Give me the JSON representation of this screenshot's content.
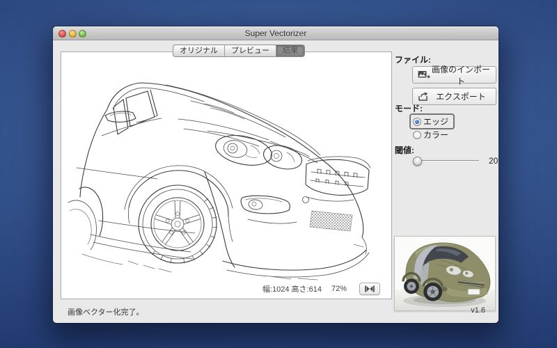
{
  "window": {
    "title": "Super Vectorizer"
  },
  "tabs": [
    {
      "label": "オリジナル",
      "selected": false
    },
    {
      "label": "プレビュー",
      "selected": false
    },
    {
      "label": "結果",
      "selected": true
    }
  ],
  "sidebar": {
    "file_section_label": "ファイル:",
    "import_button": "画像のインポート",
    "export_button": "エクスポート",
    "mode_section_label": "モード:",
    "mode_options": [
      {
        "label": "エッジ",
        "selected": true
      },
      {
        "label": "カラー",
        "selected": false
      }
    ],
    "threshold_label": "閾値:",
    "threshold_value": "20"
  },
  "canvas": {
    "size_label": "幅:1024 高さ:614",
    "zoom_label": "72%"
  },
  "footer": {
    "status_message": "画像ベクター化完了。",
    "version": "v1.6"
  },
  "icons": {
    "import": "photo-import-icon",
    "export": "export-arrow-icon",
    "fit": "fit-to-window-icon"
  },
  "colors": {
    "desktop_blue_center": "#4165ac",
    "desktop_blue_edge": "#162a52",
    "radio_accent": "#2f66c4",
    "selected_tab_gray": "#8c8c8c",
    "car_photo_body": "#8e8f69"
  }
}
